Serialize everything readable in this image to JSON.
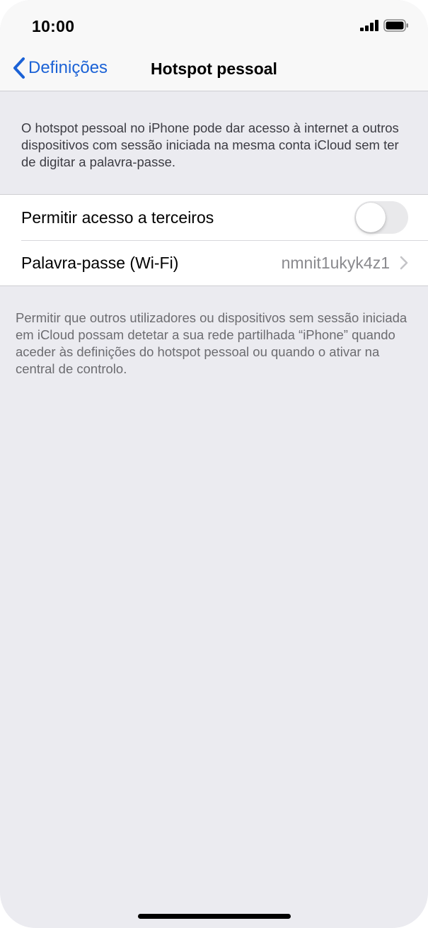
{
  "status_bar": {
    "time": "10:00",
    "signal_icon": "cellular-signal-icon",
    "battery_icon": "battery-icon"
  },
  "nav": {
    "back_label": "Definições",
    "back_icon": "chevron-left-icon",
    "title": "Hotspot pessoal"
  },
  "intro": {
    "text": "O hotspot pessoal no iPhone pode dar acesso à internet a outros dispositivos com sessão iniciada na mesma conta iCloud sem ter de digitar a palavra-passe."
  },
  "settings": {
    "allow_others": {
      "label": "Permitir acesso a terceiros",
      "enabled": false
    },
    "wifi_password": {
      "label": "Palavra-passe (Wi-Fi)",
      "value": "nmnit1ukyk4z1",
      "icon": "chevron-right-icon"
    }
  },
  "footer": {
    "text": "Permitir que outros utilizadores ou dispositivos sem sessão iniciada em iCloud possam detetar a sua rede partilhada “iPhone” quando aceder às definições do hotspot pessoal ou quando o ativar na central de controlo."
  },
  "colors": {
    "accent": "#1b62d6",
    "background": "#ebebf0",
    "toggle_off": "#e9e9eb"
  }
}
